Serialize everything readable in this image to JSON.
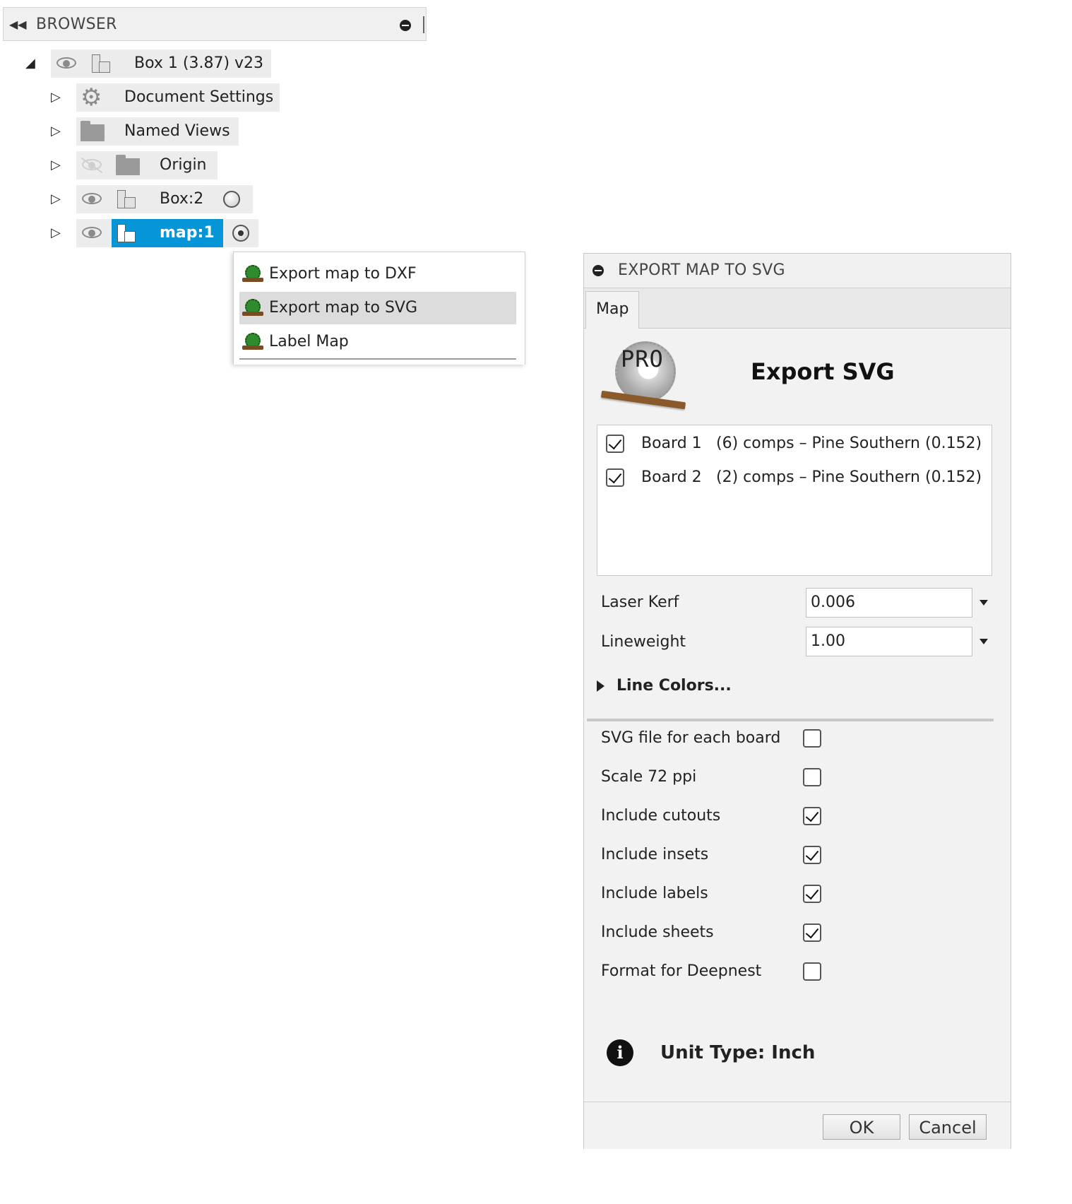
{
  "browser": {
    "title": "BROWSER",
    "root": {
      "label": "Box 1 (3.87) v23"
    },
    "items": [
      {
        "label": "Document Settings"
      },
      {
        "label": "Named Views"
      },
      {
        "label": "Origin"
      },
      {
        "label": "Box:2"
      },
      {
        "label": "map:1"
      }
    ]
  },
  "context_menu": {
    "items": [
      {
        "label": "Export map to DXF"
      },
      {
        "label": "Export map to SVG"
      },
      {
        "label": "Label Map"
      }
    ]
  },
  "dialog": {
    "title": "EXPORT MAP TO SVG",
    "tab": "Map",
    "logo_text": "PRO",
    "heading": "Export SVG",
    "boards": [
      {
        "name": "Board 1",
        "desc": "(6) comps – Pine Southern (0.152)",
        "checked": true
      },
      {
        "name": "Board 2",
        "desc": "(2) comps – Pine Southern (0.152)",
        "checked": true
      }
    ],
    "laser_kerf": {
      "label": "Laser Kerf",
      "value": "0.006"
    },
    "lineweight": {
      "label": "Lineweight",
      "value": "1.00"
    },
    "line_colors": "Line Colors...",
    "options": [
      {
        "label": "SVG file for each board",
        "checked": false
      },
      {
        "label": "Scale 72 ppi",
        "checked": false
      },
      {
        "label": "Include cutouts",
        "checked": true
      },
      {
        "label": "Include insets",
        "checked": true
      },
      {
        "label": "Include labels",
        "checked": true
      },
      {
        "label": "Include sheets",
        "checked": true
      },
      {
        "label": "Format for Deepnest",
        "checked": false
      }
    ],
    "info_icon": "i",
    "unit_type": "Unit Type: Inch",
    "ok": "OK",
    "cancel": "Cancel"
  },
  "colors": {
    "selection": "#0696d7",
    "menu_hover": "#dcdcdc"
  }
}
